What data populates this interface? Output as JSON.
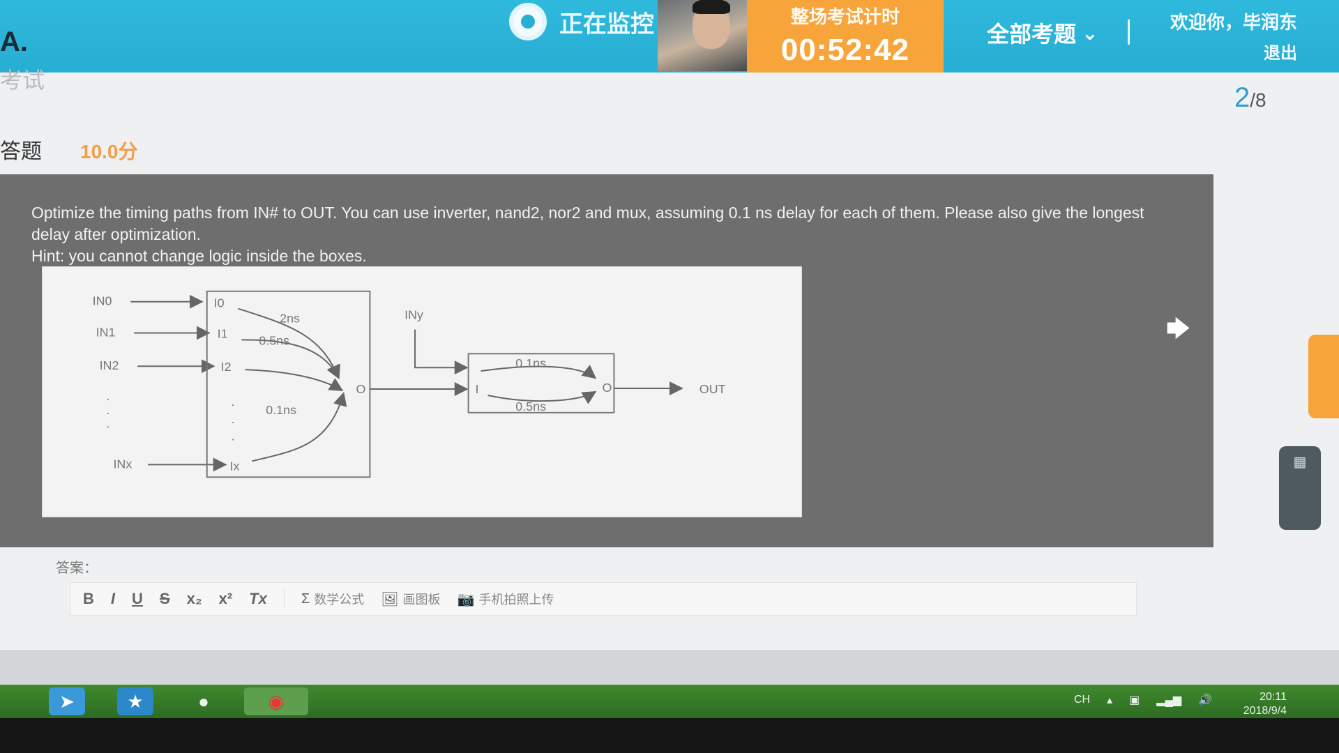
{
  "header": {
    "logo_text": "A.",
    "monitor_label": "正在监控",
    "timer_label": "整场考试计时",
    "timer_value": "00:52:42",
    "all_questions_label": "全部考题",
    "welcome_text": "欢迎你，毕润东",
    "logout_label": "退出"
  },
  "breadcrumb": {
    "exam_label": "考试"
  },
  "progress": {
    "current": "2",
    "total": "/8"
  },
  "question": {
    "type_label": "答题",
    "score": "10.0分",
    "text_line1": "Optimize the timing paths from IN# to OUT. You can use inverter, nand2, nor2 and mux, assuming 0.1 ns delay for each of them. Please also give the longest delay after optimization.",
    "text_line2": "Hint: you cannot change logic inside the boxes."
  },
  "diagram": {
    "inputs": [
      "IN0",
      "IN1",
      "IN2",
      "INx"
    ],
    "box1_ports": [
      "I0",
      "I1",
      "I2",
      "Ix"
    ],
    "box1_delays": [
      "2ns",
      "0.5ns",
      "0.1ns"
    ],
    "box1_output": "O",
    "side_input": "INy",
    "box2_delays": [
      "0.1ns",
      "0.5ns"
    ],
    "box2_input": "I",
    "box2_output": "O",
    "output_label": "OUT"
  },
  "answer": {
    "label": "答案：",
    "toolbar": {
      "bold": "B",
      "italic": "I",
      "underline": "U",
      "strike": "S",
      "subscript": "x₂",
      "superscript": "x²",
      "clear_format": "Tx",
      "formula": "数学公式",
      "drawing": "画图板",
      "photo_upload": "手机拍照上传"
    }
  },
  "taskbar": {
    "tray_lang": "CH",
    "clock_time": "20:11",
    "clock_date": "2018/9/4"
  },
  "colors": {
    "header": "#2fb9dc",
    "timer": "#f7a43a",
    "panel": "#6e6e6e",
    "progress": "#2c9fd1"
  }
}
